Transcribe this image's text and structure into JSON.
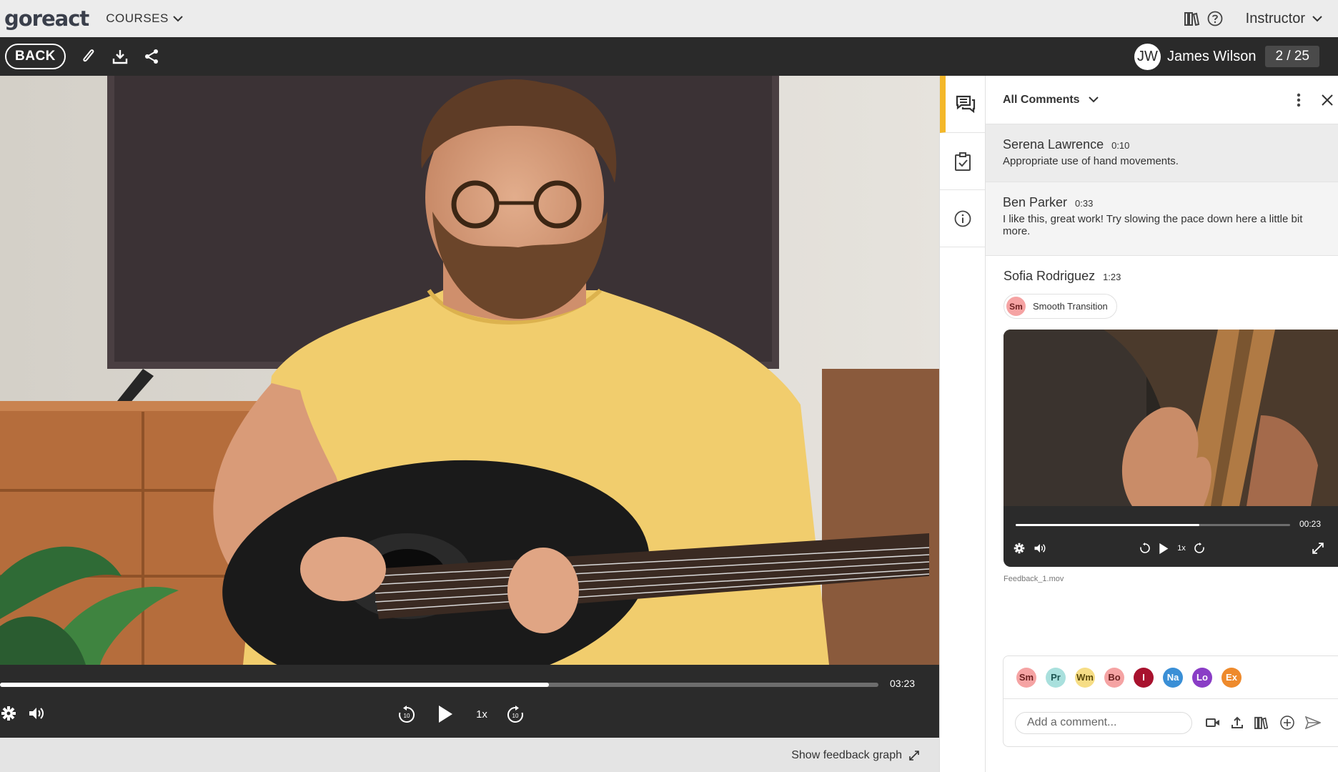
{
  "topnav": {
    "logo": "goreact",
    "courses_label": "COURSES",
    "icons": [
      "library-icon",
      "help-icon"
    ],
    "role_label": "Instructor"
  },
  "toolbar": {
    "back_label": "BACK",
    "icons": [
      "paperclip-icon",
      "download-icon",
      "share-icon"
    ],
    "user_initials": "JW",
    "user_name": "James Wilson",
    "counter": "2 / 25"
  },
  "player": {
    "duration": "03:23",
    "progress": 0.625,
    "speed": "1x",
    "skip_back": "10",
    "skip_forward": "10"
  },
  "feedback_graph_label": "Show feedback graph",
  "rail": {
    "tabs": [
      "comments-icon",
      "rubric-icon",
      "info-icon"
    ],
    "active": "comments-icon",
    "accent": "#f4b829"
  },
  "panel": {
    "title": "All Comments",
    "comments": [
      {
        "name": "Serena Lawrence",
        "time": "0:10",
        "text": "Appropriate use of hand movements."
      },
      {
        "name": "Ben Parker",
        "time": "0:33",
        "text": "I like this, great work! Try slowing the pace down here a little bit more."
      },
      {
        "name": "Sofia Rodriguez",
        "time": "1:23",
        "tag_chip": "Sm",
        "tag_label": "Smooth Transition"
      }
    ],
    "mini_player": {
      "time": "00:23",
      "progress": 0.67,
      "speed": "1x",
      "file_name": "Feedback_1.mov"
    }
  },
  "composer": {
    "chips": [
      {
        "label": "Sm",
        "bg": "#f5a3a3",
        "fg": "#6a1f1f"
      },
      {
        "label": "Pr",
        "bg": "#a9e0dd",
        "fg": "#1d5552"
      },
      {
        "label": "Wm",
        "bg": "#f6dd85",
        "fg": "#5b4a0c"
      },
      {
        "label": "Bo",
        "bg": "#f5a3a3",
        "fg": "#6a1f1f"
      },
      {
        "label": "I",
        "bg": "#a8122e",
        "fg": "#ffffff"
      },
      {
        "label": "Na",
        "bg": "#3a8fd6",
        "fg": "#ffffff"
      },
      {
        "label": "Lo",
        "bg": "#8a3dc6",
        "fg": "#ffffff"
      },
      {
        "label": "Ex",
        "bg": "#ee8a2c",
        "fg": "#ffffff"
      }
    ],
    "placeholder": "Add a comment...",
    "icons": [
      "video-camera-icon",
      "upload-icon",
      "library-icon",
      "plus-icon",
      "send-icon"
    ]
  }
}
